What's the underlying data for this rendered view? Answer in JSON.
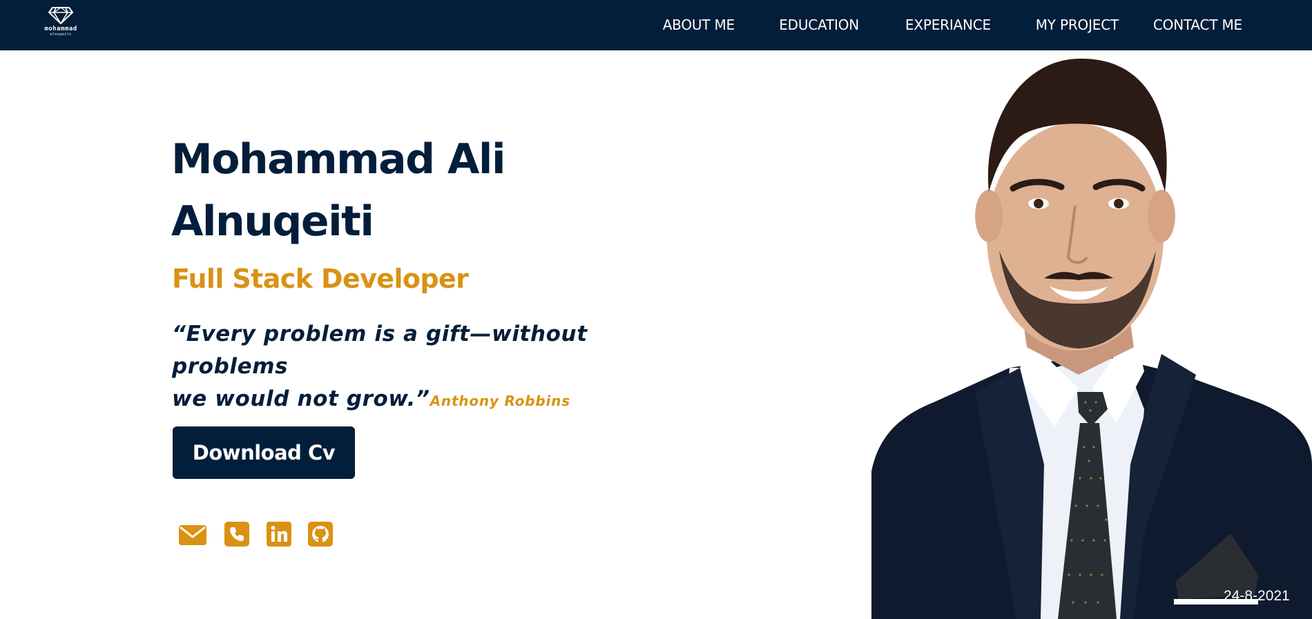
{
  "brand": {
    "logo_icon": "diamond-icon",
    "name": "mohammad",
    "subname": "alnuqeiti"
  },
  "nav": {
    "items": [
      {
        "label": "ABOUT ME"
      },
      {
        "label": "EDUCATION"
      },
      {
        "label": "EXPERIANCE"
      },
      {
        "label": "MY PROJECT"
      },
      {
        "label": "CONTACT ME"
      }
    ]
  },
  "hero": {
    "name_line1": "Mohammad Ali",
    "name_line2": "Alnuqeiti",
    "role": "Full Stack Developer",
    "quote_line1": "“Every problem is a gift—without problems",
    "quote_line2": "we would not grow.”",
    "quote_author": "Anthony Robbins",
    "download_label": "Download Cv"
  },
  "social": [
    {
      "icon": "email-icon"
    },
    {
      "icon": "phone-icon"
    },
    {
      "icon": "linkedin-icon"
    },
    {
      "icon": "github-icon"
    }
  ],
  "photo": {
    "date_stamp": "24-8-2021"
  },
  "colors": {
    "navy": "#021e3a",
    "accent": "#d99214",
    "background": "#ffffff"
  }
}
